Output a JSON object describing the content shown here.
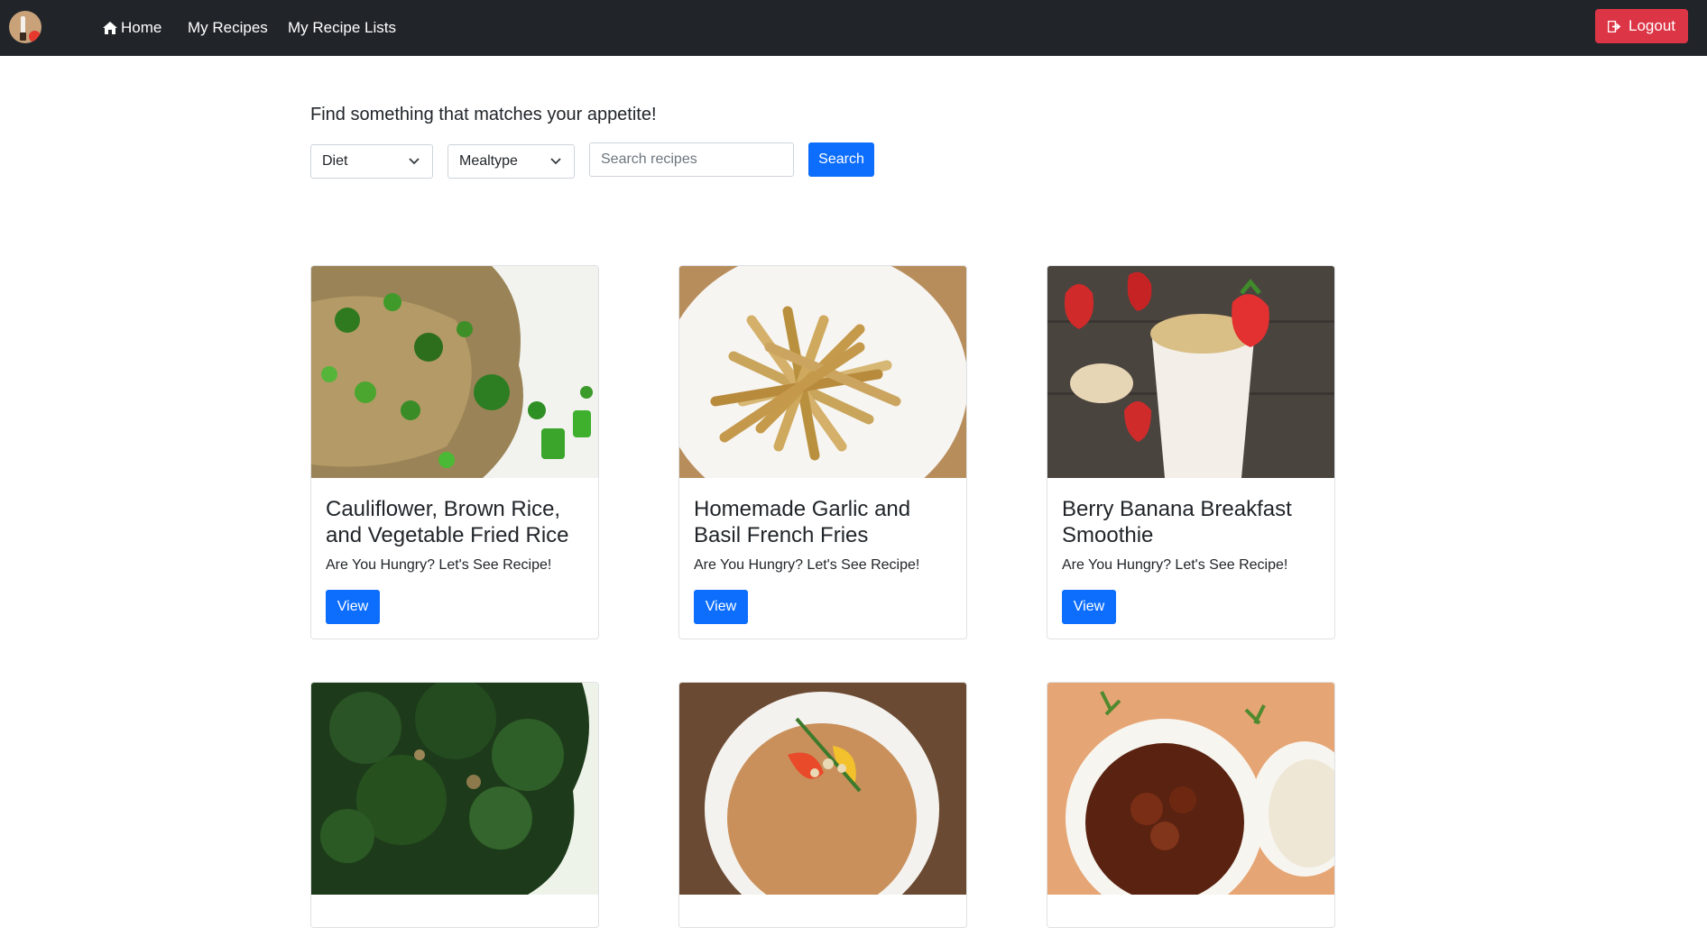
{
  "navbar": {
    "home_label": "Home",
    "my_recipes_label": "My Recipes",
    "my_recipe_lists_label": "My Recipe Lists",
    "logout_label": "Logout"
  },
  "search": {
    "tagline": "Find something that matches your appetite!",
    "diet_selected": "Diet",
    "mealtype_selected": "Mealtype",
    "placeholder": "Search recipes",
    "button_label": "Search"
  },
  "recipes": [
    {
      "title": "Cauliflower, Brown Rice, and Vegetable Fried Rice",
      "subtitle": "Are You Hungry? Let's See Recipe!",
      "button": "View"
    },
    {
      "title": "Homemade Garlic and Basil French Fries",
      "subtitle": "Are You Hungry? Let's See Recipe!",
      "button": "View"
    },
    {
      "title": "Berry Banana Breakfast Smoothie",
      "subtitle": "Are You Hungry? Let's See Recipe!",
      "button": "View"
    },
    {
      "title": "",
      "subtitle": "",
      "button": ""
    },
    {
      "title": "",
      "subtitle": "",
      "button": ""
    },
    {
      "title": "",
      "subtitle": "",
      "button": ""
    }
  ],
  "colors": {
    "navbar_bg": "#212529",
    "primary": "#0d6efd",
    "danger": "#dc3545"
  }
}
